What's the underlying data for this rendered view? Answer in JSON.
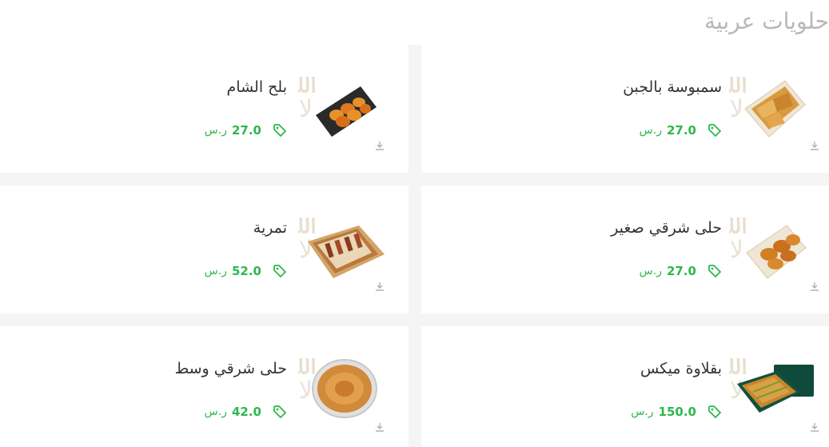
{
  "section": {
    "title": "حلويات عربية"
  },
  "colors": {
    "accent": "#2db84b",
    "title": "#b8b8b8",
    "text": "#333333"
  },
  "products": [
    {
      "name": "سمبوسة بالجبن",
      "price": "27.0",
      "currency": "ر.س",
      "image": "samosa-tray",
      "position": "right-0"
    },
    {
      "name": "بلح الشام",
      "price": "27.0",
      "currency": "ر.س",
      "image": "balah-tray",
      "position": "left-0"
    },
    {
      "name": "حلى شرقي صغير",
      "price": "27.0",
      "currency": "ر.س",
      "image": "sweets-small-tray",
      "position": "right-1"
    },
    {
      "name": "تمرية",
      "price": "52.0",
      "currency": "ر.س",
      "image": "tamria-box",
      "position": "left-1"
    },
    {
      "name": "بقلاوة ميكس",
      "price": "150.0",
      "currency": "ر.س",
      "image": "baklava-box",
      "position": "right-2"
    },
    {
      "name": "حلى شرقي وسط",
      "price": "42.0",
      "currency": "ر.س",
      "image": "sweets-round-tray",
      "position": "left-2"
    }
  ]
}
